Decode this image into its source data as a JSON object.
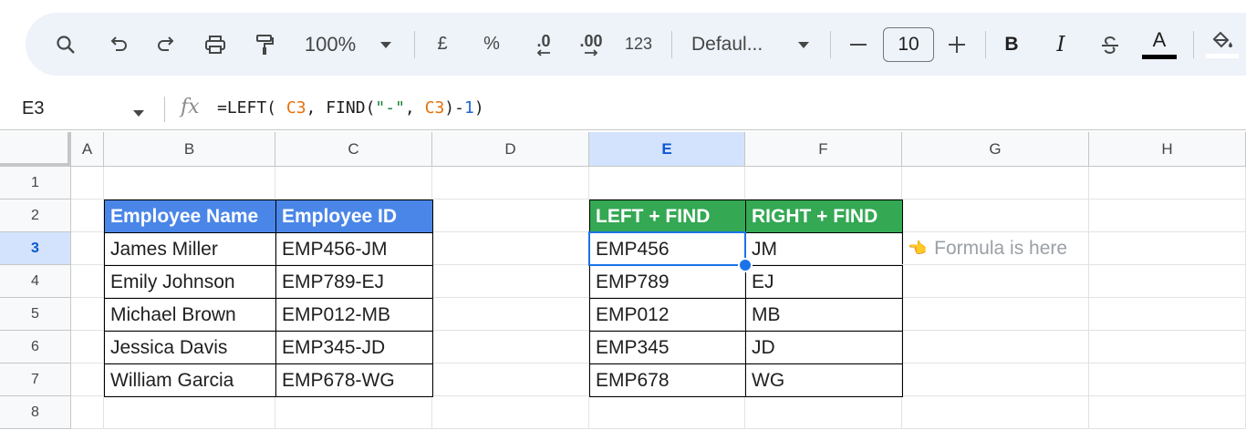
{
  "toolbar": {
    "zoom": "100%",
    "currency": "£",
    "percent": "%",
    "dec_decrease": ".0",
    "dec_increase": ".00",
    "number_format": "123",
    "font": "Defaul...",
    "font_size": "10",
    "bold": "B",
    "italic": "I",
    "text_color": "A",
    "icons": [
      "search-icon",
      "undo-icon",
      "redo-icon",
      "print-icon",
      "paint-format-icon",
      "zoom-dropdown-icon",
      "decrease-decimal-icon",
      "increase-decimal-icon",
      "font-dropdown-icon",
      "minus-icon",
      "plus-icon",
      "strikethrough-icon",
      "fill-color-icon"
    ]
  },
  "formula_bar": {
    "name_box": "E3",
    "fx": "fx",
    "formula_parts": [
      {
        "text": "=LEFT( ",
        "kind": "plain"
      },
      {
        "text": "C3",
        "kind": "ref"
      },
      {
        "text": ", FIND(",
        "kind": "plain"
      },
      {
        "text": "\"-\"",
        "kind": "str"
      },
      {
        "text": ", ",
        "kind": "plain"
      },
      {
        "text": "C3",
        "kind": "ref"
      },
      {
        "text": ")-",
        "kind": "plain"
      },
      {
        "text": "1",
        "kind": "num"
      },
      {
        "text": ")",
        "kind": "plain"
      }
    ]
  },
  "columns": [
    "A",
    "B",
    "C",
    "D",
    "E",
    "F",
    "G",
    "H"
  ],
  "rows": [
    "1",
    "2",
    "3",
    "4",
    "5",
    "6",
    "7",
    "8"
  ],
  "active_cell": {
    "column": "E",
    "row": "3"
  },
  "table1": {
    "headers": [
      "Employee Name",
      "Employee ID"
    ],
    "rows": [
      [
        "James Miller",
        "EMP456-JM"
      ],
      [
        "Emily Johnson",
        "EMP789-EJ"
      ],
      [
        "Michael Brown",
        "EMP012-MB"
      ],
      [
        "Jessica Davis",
        "EMP345-JD"
      ],
      [
        "William Garcia",
        "EMP678-WG"
      ]
    ],
    "header_color": "#4a86e8"
  },
  "table2": {
    "headers": [
      "LEFT + FIND",
      "RIGHT + FIND"
    ],
    "rows": [
      [
        "EMP456",
        "JM"
      ],
      [
        "EMP789",
        "EJ"
      ],
      [
        "EMP012",
        "MB"
      ],
      [
        "EMP345",
        "JD"
      ],
      [
        "EMP678",
        "WG"
      ]
    ],
    "header_color": "#34a853"
  },
  "note": {
    "icon": "👈",
    "text": "Formula is here"
  }
}
